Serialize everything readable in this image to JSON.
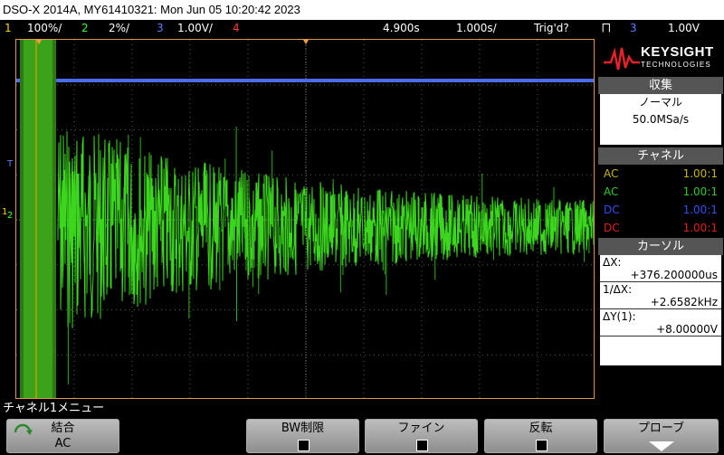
{
  "window": {
    "title": "DSO-X 2014A, MY61410321: Mon Jun 05 10:20:42 2023"
  },
  "channel_strip": {
    "ch1_num": "1",
    "ch1_scale": "100%/",
    "ch2_num": "2",
    "ch2_scale": "2%/",
    "ch3_num": "3",
    "ch3_scale": "1.00V/",
    "ch4_num": "4",
    "timebase_delay": "4.900s",
    "timebase_scale": "1.000s/",
    "trigger_status": "Trig'd?",
    "trigger_symbol": "⨅",
    "trigger_source": "3",
    "trigger_level": "1.00V",
    "colors": {
      "ch1": "#ffd400",
      "ch2": "#33ff33",
      "ch3": "#5a7dff",
      "ch4": "#ff3b3b"
    }
  },
  "markers": {
    "trigger": "T",
    "ch1": "1",
    "ch2": "2"
  },
  "brand": {
    "name": "KEYSIGHT",
    "sub": "TECHNOLOGIES"
  },
  "acquisition": {
    "header": "収集",
    "mode": "ノーマル",
    "rate": "50.0MSa/s"
  },
  "channels": {
    "header": "チャネル",
    "rows": [
      {
        "coupling": "AC",
        "ratio": "1.00:1",
        "color": "#c8b400"
      },
      {
        "coupling": "AC",
        "ratio": "1.00:1",
        "color": "#2fc82f"
      },
      {
        "coupling": "DC",
        "ratio": "1.00:1",
        "color": "#2f4ff0"
      },
      {
        "coupling": "DC",
        "ratio": "1.00:1",
        "color": "#e02020"
      }
    ]
  },
  "cursors": {
    "header": "カーソル",
    "dx_label": "ΔX:",
    "dx_value": "+376.200000us",
    "inv_dx_label": "1/ΔX:",
    "inv_dx_value": "+2.6582kHz",
    "dy_label": "ΔY(1):",
    "dy_value": "+8.00000V"
  },
  "menu": {
    "title": "チャネル1メニュー",
    "softkeys": [
      {
        "label": "結合",
        "value": "AC"
      },
      {
        "label": "BW制限"
      },
      {
        "label": "ファイン"
      },
      {
        "label": "反転"
      },
      {
        "label": "プローブ"
      }
    ]
  }
}
